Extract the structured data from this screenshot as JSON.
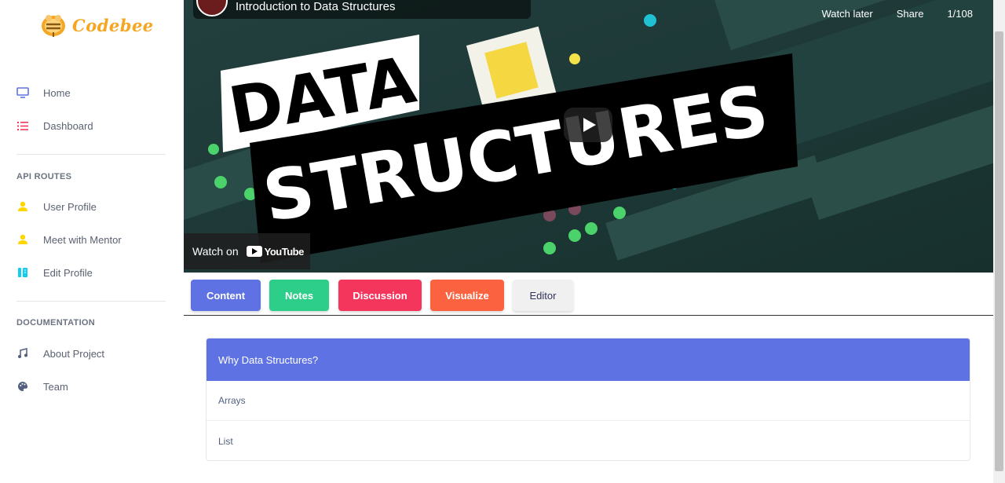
{
  "app": {
    "brand": "Codebee"
  },
  "sidebar": {
    "items": [
      {
        "label": "Home",
        "icon": "monitor-icon"
      },
      {
        "label": "Dashboard",
        "icon": "list-icon"
      }
    ],
    "api_title": "API ROUTES",
    "api_items": [
      {
        "label": "User Profile",
        "icon": "user-icon"
      },
      {
        "label": "Meet with Mentor",
        "icon": "user-icon"
      },
      {
        "label": "Edit Profile",
        "icon": "edit-profile-icon"
      }
    ],
    "doc_title": "DOCUMENTATION",
    "doc_items": [
      {
        "label": "About Project",
        "icon": "music-icon"
      },
      {
        "label": "Team",
        "icon": "palette-icon"
      }
    ]
  },
  "video": {
    "title": "Introduction to Data Structures",
    "watch_later": "Watch later",
    "share": "Share",
    "counter": "1/108",
    "watch_on": "Watch on",
    "youtube": "YouTube",
    "thumb_line1": "DATA",
    "thumb_line2": "STRUCTURES"
  },
  "tabs": [
    {
      "label": "Content",
      "color": "#5e72e4"
    },
    {
      "label": "Notes",
      "color": "#2dce89"
    },
    {
      "label": "Discussion",
      "color": "#f5365c"
    },
    {
      "label": "Visualize",
      "color": "#fb6340"
    },
    {
      "label": "Editor",
      "color": "#f0f0f0"
    }
  ],
  "accordion": {
    "header": "Why Data Structures?",
    "items": [
      "Arrays",
      "List"
    ]
  }
}
